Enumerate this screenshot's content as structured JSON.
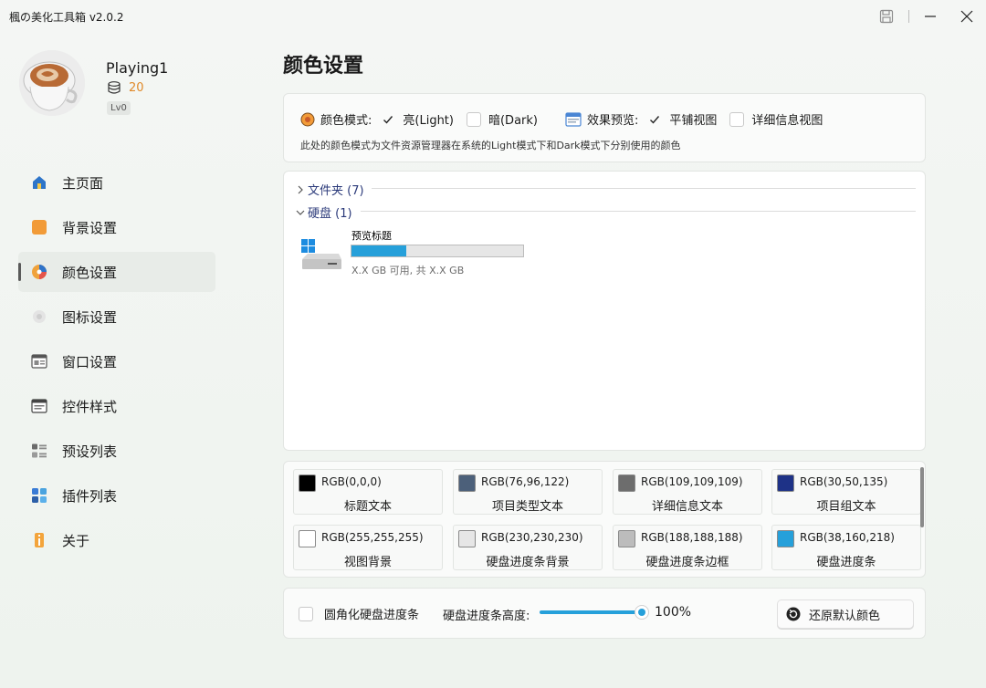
{
  "window": {
    "title": "楓の美化工具箱 v2.0.2"
  },
  "profile": {
    "name": "Playing1",
    "coins": "20",
    "level": "Lv0"
  },
  "nav": [
    {
      "label": "主页面",
      "icon": "home-icon"
    },
    {
      "label": "背景设置",
      "icon": "background-icon"
    },
    {
      "label": "颜色设置",
      "icon": "palette-icon",
      "active": true
    },
    {
      "label": "图标设置",
      "icon": "icon-settings-icon"
    },
    {
      "label": "窗口设置",
      "icon": "window-icon"
    },
    {
      "label": "控件样式",
      "icon": "control-style-icon"
    },
    {
      "label": "预设列表",
      "icon": "preset-list-icon"
    },
    {
      "label": "插件列表",
      "icon": "plugin-list-icon"
    },
    {
      "label": "关于",
      "icon": "info-icon"
    }
  ],
  "page": {
    "title": "颜色设置"
  },
  "mode": {
    "color_mode_label": "颜色模式:",
    "light_label": "亮(Light)",
    "light_checked": true,
    "dark_label": "暗(Dark)",
    "dark_checked": false,
    "preview_label": "效果预览:",
    "tile_label": "平铺视图",
    "tile_checked": true,
    "detail_label": "详细信息视图",
    "detail_checked": false,
    "description": "此处的颜色模式为文件资源管理器在系统的Light模式下和Dark模式下分别使用的颜色"
  },
  "preview": {
    "groups": [
      {
        "label": "文件夹 (7)",
        "expanded": false
      },
      {
        "label": "硬盘 (1)",
        "expanded": true
      }
    ],
    "drive": {
      "title": "预览标题",
      "info": "X.X GB 可用, 共 X.X GB",
      "usage_fraction": 0.32
    }
  },
  "colors": [
    {
      "rgb": "RGB(0,0,0)",
      "name": "标题文本",
      "hex": "#000000"
    },
    {
      "rgb": "RGB(76,96,122)",
      "name": "项目类型文本",
      "hex": "#4c607a"
    },
    {
      "rgb": "RGB(109,109,109)",
      "name": "详细信息文本",
      "hex": "#6d6d6d"
    },
    {
      "rgb": "RGB(30,50,135)",
      "name": "项目组文本",
      "hex": "#1e3287"
    },
    {
      "rgb": "RGB(255,255,255)",
      "name": "视图背景",
      "hex": "#ffffff"
    },
    {
      "rgb": "RGB(230,230,230)",
      "name": "硬盘进度条背景",
      "hex": "#e6e6e6"
    },
    {
      "rgb": "RGB(188,188,188)",
      "name": "硬盘进度条边框",
      "hex": "#bcbcbc"
    },
    {
      "rgb": "RGB(38,160,218)",
      "name": "硬盘进度条",
      "hex": "#26a0da"
    }
  ],
  "bottom": {
    "round_label": "圆角化硬盘进度条",
    "round_checked": false,
    "height_label": "硬盘进度条高度:",
    "height_value": "100%",
    "height_fraction": 1.0,
    "reset_label": "还原默认颜色"
  },
  "theme": {
    "accent": "#26a0da"
  }
}
